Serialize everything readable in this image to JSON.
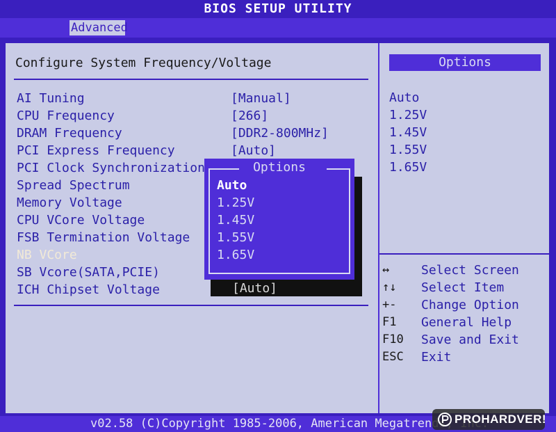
{
  "title": "BIOS SETUP UTILITY",
  "menu": {
    "active_tab": "Advanced"
  },
  "section_title": "Configure System Frequency/Voltage",
  "settings": [
    {
      "label": "AI Tuning",
      "value": "[Manual]",
      "disabled": false
    },
    {
      "label": "CPU Frequency",
      "value": "[266]",
      "disabled": false
    },
    {
      "label": "DRAM Frequency",
      "value": "[DDR2-800MHz]",
      "disabled": false
    },
    {
      "label": "PCI Express Frequency",
      "value": "[Auto]",
      "disabled": false
    },
    {
      "label": "PCI Clock Synchronization M",
      "value": "",
      "disabled": false
    },
    {
      "label": "Spread Spectrum",
      "value": "",
      "disabled": false
    },
    {
      "label": "Memory Voltage",
      "value": "",
      "disabled": false
    },
    {
      "label": "CPU VCore Voltage",
      "value": "",
      "disabled": false
    },
    {
      "label": "FSB Termination Voltage",
      "value": "",
      "disabled": false
    },
    {
      "label": "NB VCore",
      "value": "",
      "disabled": true
    },
    {
      "label": "SB Vcore(SATA,PCIE)",
      "value": "",
      "disabled": false
    },
    {
      "label": "ICH Chipset Voltage",
      "value": "",
      "disabled": false
    }
  ],
  "selected_value": "[Auto]",
  "options_panel": {
    "header": "Options",
    "items": [
      "Auto",
      "1.25V",
      "1.45V",
      "1.55V",
      "1.65V"
    ]
  },
  "popup": {
    "title": "Options",
    "items": [
      "Auto",
      "1.25V",
      "1.45V",
      "1.55V",
      "1.65V"
    ],
    "selected_index": 0
  },
  "help_keys": [
    {
      "key": "↔",
      "desc": "Select Screen"
    },
    {
      "key": "↑↓",
      "desc": "Select Item"
    },
    {
      "key": "+-",
      "desc": "Change Option"
    },
    {
      "key": "F1",
      "desc": "General Help"
    },
    {
      "key": "F10",
      "desc": "Save and Exit"
    },
    {
      "key": "ESC",
      "desc": "Exit"
    }
  ],
  "footer": {
    "copyright": "v02.58 (C)Copyright 1985-2006, American Megatrends, Inc."
  },
  "watermark": {
    "text": "PROHARDVER!",
    "icon": "prohardver-logo-icon"
  },
  "colors": {
    "background_blue": "#3a1fbe",
    "bar_blue": "#4f2ed8",
    "panel_gray": "#c9cce6",
    "text_blue": "#2a1fa8",
    "disabled_text": "#f2ead7"
  }
}
